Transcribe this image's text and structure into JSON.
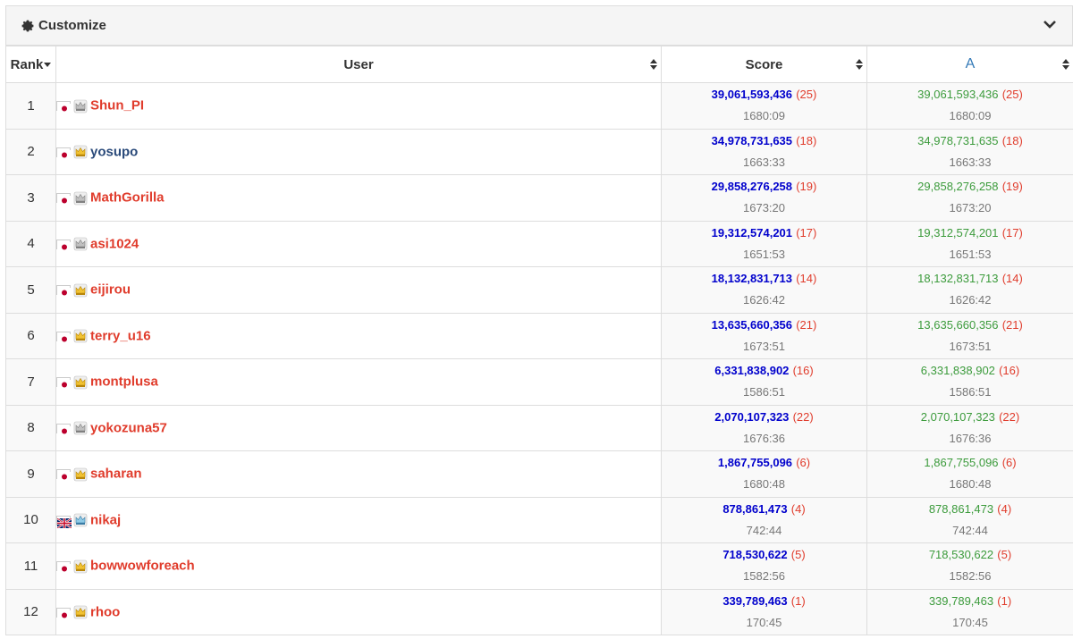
{
  "customize": {
    "label": "Customize"
  },
  "header": {
    "rank": "Rank",
    "user": "User",
    "score": "Score",
    "task": "A"
  },
  "colors": {
    "user_red": "#e03c2c",
    "user_blue": "#2a4a7a",
    "score_blue": "#0000cc",
    "task_green": "#3c9b3c",
    "penalty_red": "#e03c2c"
  },
  "rows": [
    {
      "rank": "1",
      "flag": "jp",
      "crown": "silver",
      "user": "Shun_PI",
      "user_color": "red",
      "score": "39,061,593,436",
      "penalty": "(25)",
      "time": "1680:09",
      "task_score": "39,061,593,436",
      "task_penalty": "(25)",
      "task_time": "1680:09"
    },
    {
      "rank": "2",
      "flag": "jp",
      "crown": "gold",
      "user": "yosupo",
      "user_color": "blue",
      "score": "34,978,731,635",
      "penalty": "(18)",
      "time": "1663:33",
      "task_score": "34,978,731,635",
      "task_penalty": "(18)",
      "task_time": "1663:33"
    },
    {
      "rank": "3",
      "flag": "jp",
      "crown": "silver",
      "user": "MathGorilla",
      "user_color": "red",
      "score": "29,858,276,258",
      "penalty": "(19)",
      "time": "1673:20",
      "task_score": "29,858,276,258",
      "task_penalty": "(19)",
      "task_time": "1673:20"
    },
    {
      "rank": "4",
      "flag": "jp",
      "crown": "silver",
      "user": "asi1024",
      "user_color": "red",
      "score": "19,312,574,201",
      "penalty": "(17)",
      "time": "1651:53",
      "task_score": "19,312,574,201",
      "task_penalty": "(17)",
      "task_time": "1651:53"
    },
    {
      "rank": "5",
      "flag": "jp",
      "crown": "gold",
      "user": "eijirou",
      "user_color": "red",
      "score": "18,132,831,713",
      "penalty": "(14)",
      "time": "1626:42",
      "task_score": "18,132,831,713",
      "task_penalty": "(14)",
      "task_time": "1626:42"
    },
    {
      "rank": "6",
      "flag": "jp",
      "crown": "gold",
      "user": "terry_u16",
      "user_color": "red",
      "score": "13,635,660,356",
      "penalty": "(21)",
      "time": "1673:51",
      "task_score": "13,635,660,356",
      "task_penalty": "(21)",
      "task_time": "1673:51"
    },
    {
      "rank": "7",
      "flag": "jp",
      "crown": "gold",
      "user": "montplusa",
      "user_color": "red",
      "score": "6,331,838,902",
      "penalty": "(16)",
      "time": "1586:51",
      "task_score": "6,331,838,902",
      "task_penalty": "(16)",
      "task_time": "1586:51"
    },
    {
      "rank": "8",
      "flag": "jp",
      "crown": "silver",
      "user": "yokozuna57",
      "user_color": "red",
      "score": "2,070,107,323",
      "penalty": "(22)",
      "time": "1676:36",
      "task_score": "2,070,107,323",
      "task_penalty": "(22)",
      "task_time": "1676:36"
    },
    {
      "rank": "9",
      "flag": "jp",
      "crown": "gold",
      "user": "saharan",
      "user_color": "red",
      "score": "1,867,755,096",
      "penalty": "(6)",
      "time": "1680:48",
      "task_score": "1,867,755,096",
      "task_penalty": "(6)",
      "task_time": "1680:48"
    },
    {
      "rank": "10",
      "flag": "gb",
      "crown": "blue",
      "user": "nikaj",
      "user_color": "red",
      "score": "878,861,473",
      "penalty": "(4)",
      "time": "742:44",
      "task_score": "878,861,473",
      "task_penalty": "(4)",
      "task_time": "742:44"
    },
    {
      "rank": "11",
      "flag": "jp",
      "crown": "gold",
      "user": "bowwowforeach",
      "user_color": "red",
      "score": "718,530,622",
      "penalty": "(5)",
      "time": "1582:56",
      "task_score": "718,530,622",
      "task_penalty": "(5)",
      "task_time": "1582:56"
    },
    {
      "rank": "12",
      "flag": "jp",
      "crown": "gold",
      "user": "rhoo",
      "user_color": "red",
      "score": "339,789,463",
      "penalty": "(1)",
      "time": "170:45",
      "task_score": "339,789,463",
      "task_penalty": "(1)",
      "task_time": "170:45"
    }
  ]
}
